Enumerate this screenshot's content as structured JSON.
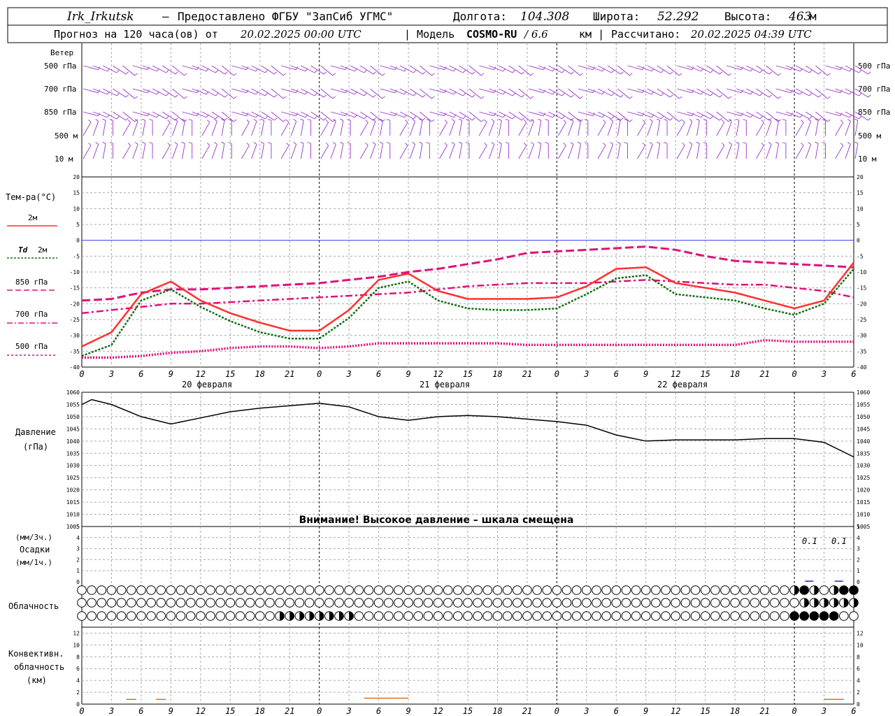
{
  "header": {
    "station": "Irk_Irkutsk",
    "dash": "—",
    "provider": "Предоставлено ФГБУ \"ЗапСиб УГМС\"",
    "lon_label": "Долгота:",
    "lon_value": "104.308",
    "lat_label": "Широта:",
    "lat_value": "52.292",
    "alt_label": "Высота:",
    "alt_value": "463",
    "alt_unit": "м",
    "forecast_prefix": "Прогноз на 120 часа(ов) от",
    "forecast_date": "20.02.2025 00:00 UTC",
    "model_label": "| Модель",
    "model_name": "COSMO-RU",
    "model_res": "/ 6.6",
    "model_res_unit": "км |",
    "calc_label": "Рассчитано:",
    "calc_date": "20.02.2025 04:39 UTC"
  },
  "wind_panel": {
    "title": "Ветер",
    "levels": [
      "500 гПа",
      "700 гПа",
      "850 гПа",
      "500 м",
      "10 м"
    ],
    "color": "#9932cc"
  },
  "temp_panel": {
    "title": "Тем-ра(°C)",
    "legend": [
      {
        "label": "2м",
        "color": "#ff3030"
      },
      {
        "label_italic": "Td",
        "label": "2м",
        "color": "#107010"
      },
      {
        "label": "850 гПа",
        "color": "#e0107a"
      },
      {
        "label": "700 гПа",
        "color": "#e0107a"
      },
      {
        "label": "500 гПа",
        "color": "#e0107a"
      }
    ]
  },
  "pressure_panel": {
    "title_line1": "Давление",
    "title_line2": "(гПа)",
    "warning": "Внимание! Высокое давление – шкала смещена"
  },
  "precip_panel": {
    "label_line1": "(мм/3ч.)",
    "label_line2": "Осадки",
    "label_line3": "(мм/1ч.)",
    "annotations": [
      "0.1",
      "0.1"
    ]
  },
  "cloud_panel": {
    "label": "Облачность"
  },
  "convective_panel": {
    "label_line1": "Конвективн.",
    "label_line2": "облачность",
    "label_line3": "(км)"
  },
  "x_axis": {
    "hour_ticks": [
      "0",
      "3",
      "6",
      "9",
      "12",
      "15",
      "18",
      "21",
      "0",
      "3",
      "6",
      "9",
      "12",
      "15",
      "18",
      "21",
      "0",
      "3",
      "6",
      "9",
      "12",
      "15",
      "18",
      "21",
      "0",
      "3",
      "6"
    ],
    "day_labels": [
      "20 февраля",
      "21 февраля",
      "22 февраля"
    ]
  },
  "chart_data": [
    {
      "type": "line",
      "name": "temperature",
      "ylim": [
        -40,
        20
      ],
      "yticks": [
        -40,
        -35,
        -30,
        -25,
        -20,
        -15,
        -10,
        -5,
        0,
        5,
        10,
        15,
        20
      ],
      "x_hours": [
        0,
        3,
        6,
        9,
        12,
        15,
        18,
        21,
        24,
        27,
        30,
        33,
        36,
        39,
        42,
        45,
        48,
        51,
        54,
        57,
        60,
        63,
        66,
        69,
        72,
        75,
        78
      ],
      "series": [
        {
          "name": "2м",
          "values": [
            -33.5,
            -29,
            -17,
            -13,
            -19,
            -23,
            -26,
            -28.5,
            -28.5,
            -22,
            -12.5,
            -10.5,
            -16,
            -18.5,
            -18.5,
            -18.5,
            -18,
            -14.5,
            -9,
            -8.5,
            -13.5,
            -15,
            -16.5,
            -19,
            -21.5,
            -19,
            -7
          ],
          "color": "#ff3030",
          "style": "solid"
        },
        {
          "name": "Td 2м",
          "values": [
            -36.5,
            -33,
            -19,
            -15.5,
            -21,
            -25.5,
            -29,
            -31,
            -31,
            -24.5,
            -15,
            -13,
            -19,
            -21.5,
            -22,
            -22,
            -21.5,
            -17,
            -12,
            -11,
            -17,
            -18,
            -19,
            -21.5,
            -23.5,
            -20,
            -9
          ],
          "color": "#107010",
          "style": "dotted"
        },
        {
          "name": "850 гПа",
          "values": [
            -19,
            -18.5,
            -16.5,
            -15.5,
            -15.5,
            -15,
            -14.5,
            -14,
            -13.5,
            -12.5,
            -11.5,
            -10,
            -9,
            -7.5,
            -6,
            -4,
            -3.5,
            -3,
            -2.5,
            -2,
            -3,
            -5,
            -6.5,
            -7,
            -7.5,
            -8,
            -8.5
          ],
          "color": "#e0107a",
          "style": "dashed"
        },
        {
          "name": "700 гПа",
          "values": [
            -23,
            -22,
            -21,
            -20,
            -20,
            -19.5,
            -19,
            -18.5,
            -18,
            -17.5,
            -17,
            -16.5,
            -15.5,
            -14.5,
            -14,
            -13.5,
            -13.5,
            -13.5,
            -13,
            -12.5,
            -13,
            -13.5,
            -14,
            -14,
            -15,
            -16,
            -18
          ],
          "color": "#e0107a",
          "style": "dashdot"
        },
        {
          "name": "500 гПа",
          "values": [
            -37,
            -37,
            -36.5,
            -35.5,
            -35,
            -34,
            -33.5,
            -33.5,
            -34,
            -33.5,
            -32.5,
            -32.5,
            -32.5,
            -32.5,
            -32.5,
            -33,
            -33,
            -33,
            -33,
            -33,
            -33,
            -33,
            -33,
            -31.5,
            -32,
            -32,
            -32
          ],
          "color": "#e0107a",
          "style": "dotted"
        }
      ]
    },
    {
      "type": "line",
      "name": "pressure",
      "ylim": [
        1005,
        1060
      ],
      "yticks": [
        1005,
        1010,
        1015,
        1020,
        1025,
        1030,
        1035,
        1040,
        1045,
        1050,
        1055,
        1060
      ],
      "x_hours": [
        0,
        1,
        3,
        6,
        9,
        12,
        15,
        18,
        21,
        24,
        27,
        30,
        33,
        36,
        39,
        42,
        45,
        48,
        51,
        54,
        57,
        60,
        63,
        66,
        69,
        72,
        75,
        78
      ],
      "values": [
        1055,
        1057,
        1055,
        1050,
        1047,
        1049.5,
        1052,
        1053.5,
        1054.5,
        1055.5,
        1054,
        1050,
        1048.5,
        1050,
        1050.5,
        1050,
        1049,
        1048,
        1046.5,
        1042.5,
        1040,
        1040.5,
        1040.5,
        1040.5,
        1041,
        1041,
        1039.5,
        1033.5
      ],
      "color": "#000000"
    },
    {
      "type": "bar",
      "name": "precipitation",
      "ylim": [
        0,
        5
      ],
      "yticks": [
        0,
        1,
        2,
        3,
        4,
        5
      ],
      "x_hours": [
        73.5,
        76.5
      ],
      "values": [
        0.1,
        0.1
      ],
      "color": "#1f3fa0"
    },
    {
      "type": "bar",
      "name": "convective_cloud",
      "ylim": [
        0,
        13
      ],
      "yticks": [
        0,
        2,
        4,
        6,
        8,
        10,
        12
      ],
      "segments": [
        {
          "x_start": 4.5,
          "x_end": 5.5,
          "value": 0.8
        },
        {
          "x_start": 7.5,
          "x_end": 8.5,
          "value": 0.8
        },
        {
          "x_start": 28.5,
          "x_end": 33,
          "value": 1.0
        },
        {
          "x_start": 75,
          "x_end": 77,
          "value": 0.8
        }
      ],
      "color": "#e07020"
    }
  ]
}
